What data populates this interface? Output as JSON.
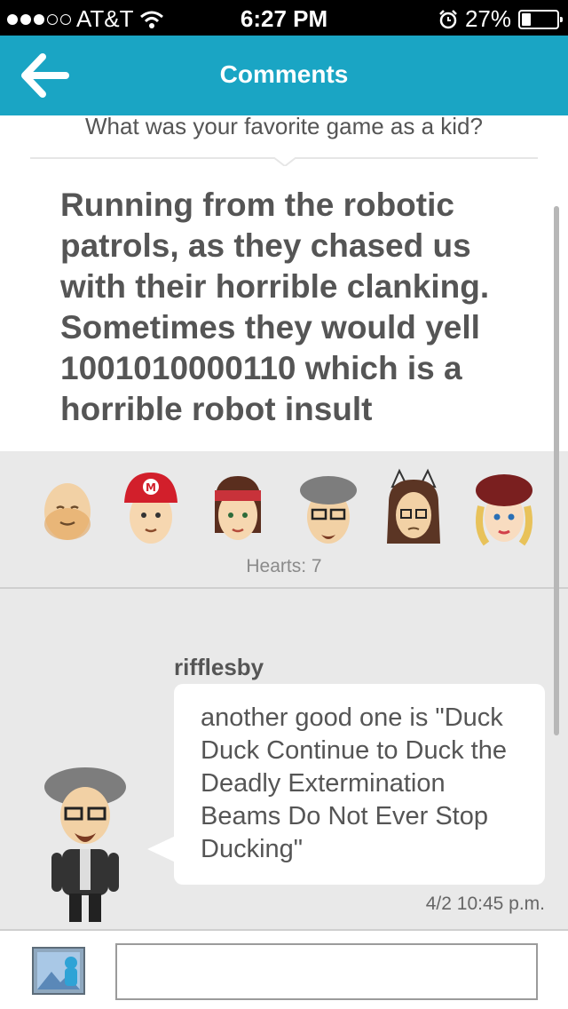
{
  "status_bar": {
    "carrier": "AT&T",
    "time": "6:27 PM",
    "battery": "27%",
    "battery_level": 0.27,
    "signal_bars": 3,
    "signal_total": 5
  },
  "nav": {
    "title": "Comments",
    "back_icon": "arrow-left-icon"
  },
  "post": {
    "question": "What was your favorite game as a kid?",
    "answer": "Running from the robotic patrols, as they chased us with their horrible clanking. Sometimes they would yell 1001010000110 which is a horrible robot insult"
  },
  "hearts": {
    "label": "Hearts: 7"
  },
  "comment": {
    "username": "rifflesby",
    "text": "another good one is \"Duck Duck Continue to Duck the Deadly Extermination Beams Do Not Ever Stop Ducking\"",
    "timestamp": "4/2 10:45 p.m."
  },
  "colors": {
    "accent": "#1aa5c4",
    "panel_bg": "#e9e9e9",
    "text": "#555555"
  }
}
